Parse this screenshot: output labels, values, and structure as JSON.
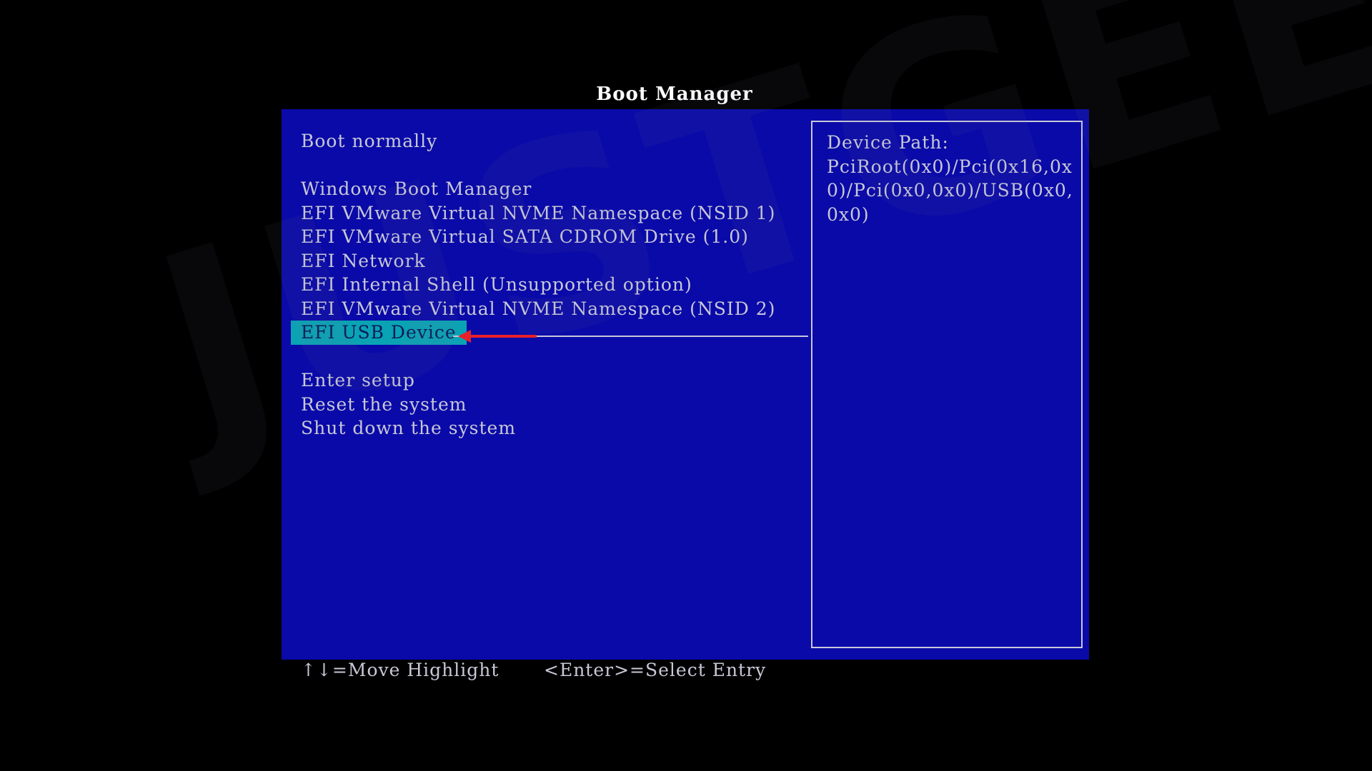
{
  "window": {
    "title": "Boot Manager"
  },
  "menu": {
    "items": [
      {
        "label": "Boot normally"
      },
      {
        "label": "Windows Boot Manager"
      },
      {
        "label": "EFI VMware Virtual NVME Namespace (NSID 1)"
      },
      {
        "label": "EFI VMware Virtual SATA CDROM Drive (1.0)"
      },
      {
        "label": "EFI Network"
      },
      {
        "label": "EFI Internal Shell (Unsupported option)"
      },
      {
        "label": "EFI VMware Virtual NVME Namespace (NSID 2)"
      },
      {
        "label": "EFI USB Device",
        "selected": true
      },
      {
        "label": "Enter setup"
      },
      {
        "label": "Reset the system"
      },
      {
        "label": "Shut down the system"
      }
    ]
  },
  "info": {
    "heading": "Device Path:",
    "lines": [
      "PciRoot(0x0)/Pci(0x16,0x",
      "0)/Pci(0x0,0x0)/USB(0x0,",
      "0x0)"
    ]
  },
  "footer": {
    "move_hint": "↑↓=Move Highlight",
    "select_hint": "<Enter>=Select Entry"
  },
  "watermark": {
    "text": "JUSTGEEK"
  },
  "colors": {
    "background": "#000000",
    "panel": "#0a0aa8",
    "text": "#c8c8d8",
    "highlight": "#0aa3b4",
    "highlight_text": "#071a5a",
    "arrow": "#e8202a"
  }
}
